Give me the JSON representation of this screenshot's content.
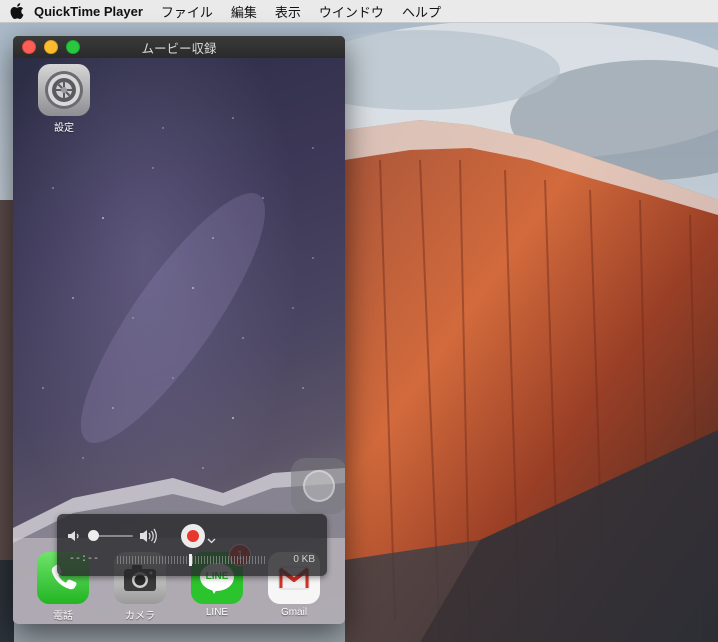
{
  "menubar": {
    "app_name": "QuickTime Player",
    "items": [
      "ファイル",
      "編集",
      "表示",
      "ウインドウ",
      "ヘルプ"
    ]
  },
  "window": {
    "title": "ムービー収録"
  },
  "home_screen": {
    "apps": [
      {
        "label": "設定",
        "icon": "settings-gear-icon"
      }
    ],
    "dock": [
      {
        "label": "電話",
        "icon": "phone-icon"
      },
      {
        "label": "カメラ",
        "icon": "camera-icon"
      },
      {
        "label": "LINE",
        "icon": "line-icon",
        "badge": "1",
        "icon_text": "LINE"
      },
      {
        "label": "Gmail",
        "icon": "gmail-icon"
      }
    ]
  },
  "recorder": {
    "time": "--:--",
    "size": "0 KB",
    "volume_level": 0.0,
    "record_color": "#e8372d"
  },
  "colors": {
    "close": "#fc5f57",
    "minimize": "#fdbc2e",
    "maximize": "#28c840"
  }
}
